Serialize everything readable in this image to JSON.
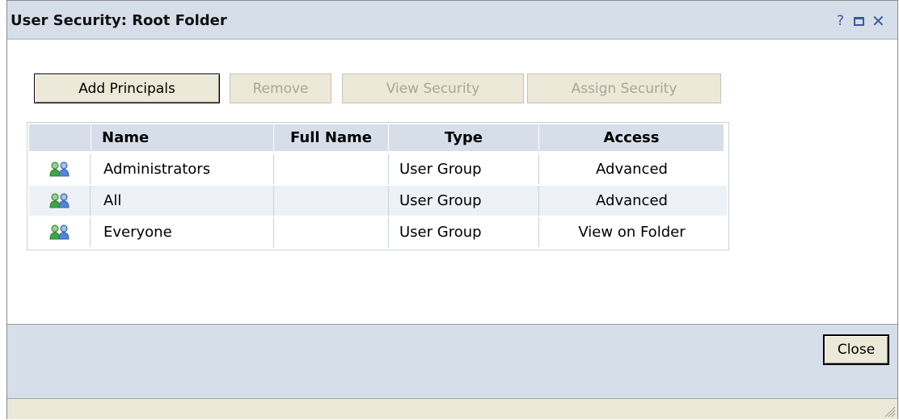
{
  "dialog": {
    "title": "User Security: Root Folder",
    "help_icon": "?",
    "close_icon": "✕"
  },
  "toolbar": {
    "add_principals": "Add Principals",
    "remove": "Remove",
    "view_security": "View Security",
    "assign_security": "Assign Security"
  },
  "table": {
    "headers": [
      "Name",
      "Full Name",
      "Type",
      "Access"
    ],
    "rows": [
      {
        "icon": "user-group-icon",
        "name": "Administrators",
        "full_name": "",
        "type": "User Group",
        "access": "Advanced"
      },
      {
        "icon": "user-group-icon",
        "name": "All",
        "full_name": "",
        "type": "User Group",
        "access": "Advanced"
      },
      {
        "icon": "user-group-icon",
        "name": "Everyone",
        "full_name": "",
        "type": "User Group",
        "access": "View on Folder"
      }
    ]
  },
  "footer": {
    "close_label": "Close"
  },
  "colors": {
    "title_bar": "#d6deea",
    "button_face": "#ece9d8",
    "disabled_text": "#a9a69a",
    "icon_green": "#3aa84a",
    "icon_blue": "#4f86d9"
  }
}
